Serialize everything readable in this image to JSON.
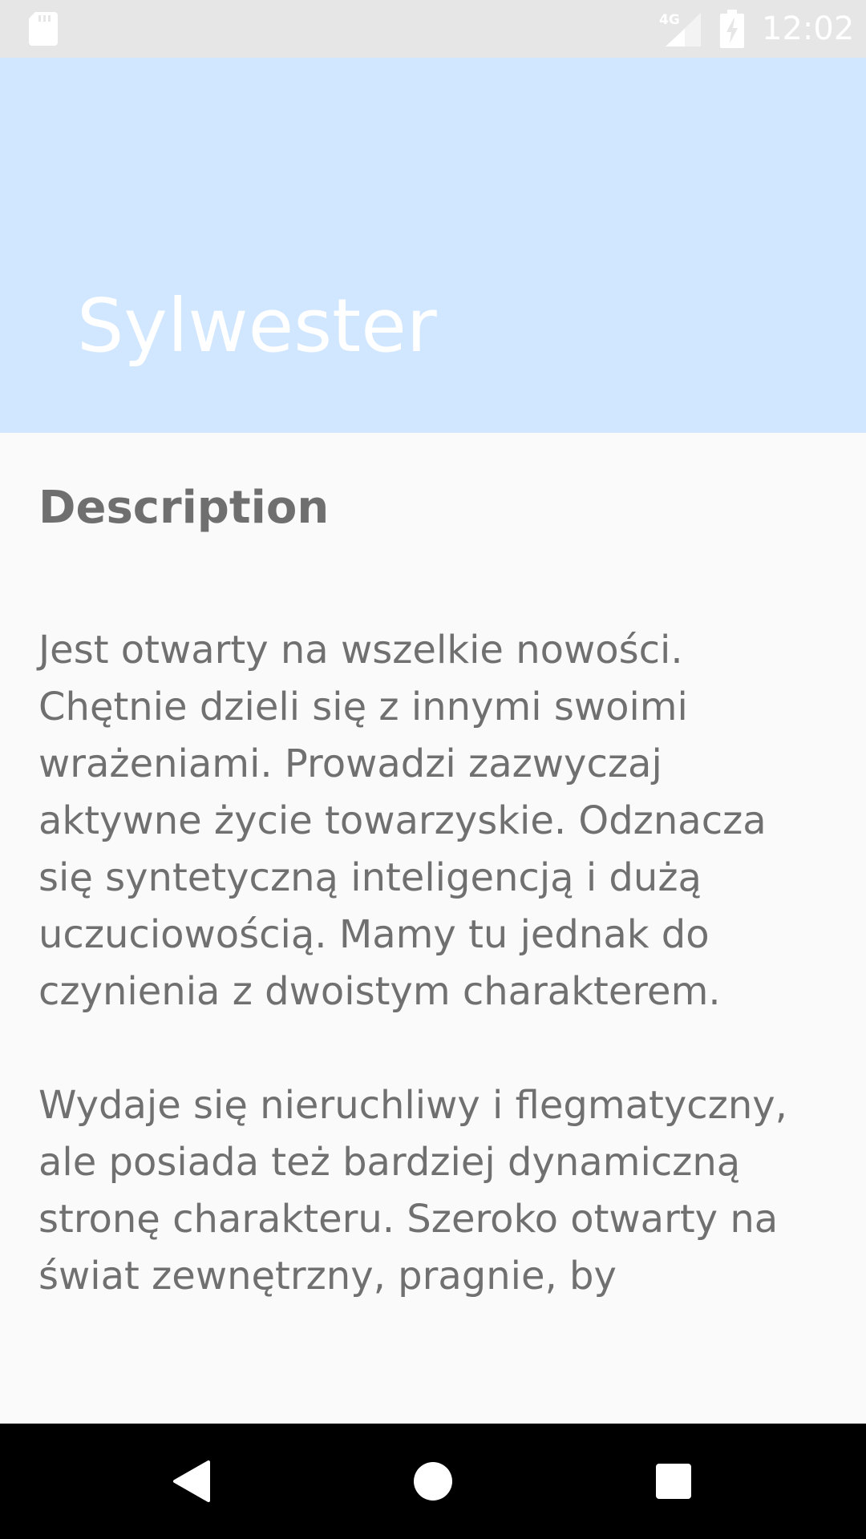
{
  "status_bar": {
    "time": "12:02",
    "network_label": "4G",
    "icons": {
      "sd_card": "sd-card-icon",
      "network": "signal-4g-icon",
      "battery": "battery-charging-icon"
    }
  },
  "app_bar": {
    "title": "Sylwester",
    "background_color": "#d1e7ff"
  },
  "content": {
    "heading": "Description",
    "paragraphs": [
      "Jest otwarty na wszelkie nowości. Chętnie dzieli się z innymi swoimi wrażeniami. Prowadzi zazwyczaj aktywne życie towarzyskie. Odznacza się syntetyczną inteligencją i dużą uczuciowością. Mamy tu jednak do czynienia z dwoistym charakterem.",
      "Wydaje się nieruchliwy i flegmatyczny, ale posiada też bardziej dynamiczną stronę charakteru. Szeroko otwarty na świat zewnętrzny, pragnie, by"
    ]
  },
  "nav_bar": {
    "icons": {
      "back": "back-triangle-icon",
      "home": "home-circle-icon",
      "recents": "recents-square-icon"
    }
  }
}
